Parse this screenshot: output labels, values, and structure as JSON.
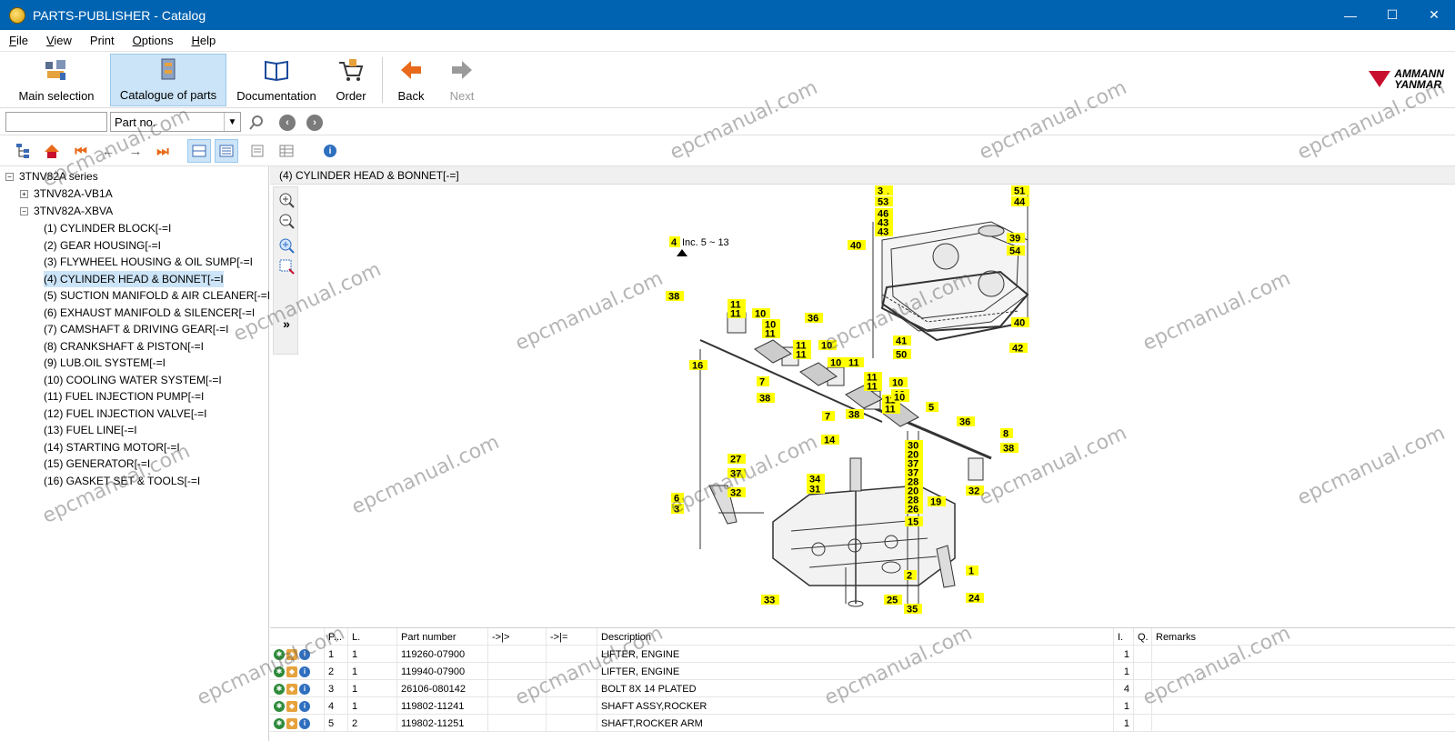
{
  "window": {
    "title": "PARTS-PUBLISHER - Catalog",
    "minimize": "—",
    "maximize": "☐",
    "close": "✕"
  },
  "menu": [
    {
      "u": "F",
      "rest": "ile"
    },
    {
      "u": "V",
      "rest": "iew"
    },
    {
      "u": "",
      "rest": "Print"
    },
    {
      "u": "O",
      "rest": "ptions"
    },
    {
      "u": "H",
      "rest": "elp"
    }
  ],
  "toolbar": {
    "main_selection": "Main selection",
    "catalogue": "Catalogue of parts",
    "documentation": "Documentation",
    "order": "Order",
    "back": "Back",
    "next": "Next"
  },
  "brand": {
    "line1": "AMMANN",
    "line2": "YANMAR",
    "color": "#c8102e"
  },
  "search": {
    "value": "",
    "combo_value": "Part no."
  },
  "tree": {
    "root": "3TNV82A series",
    "node1": "3TNV82A-VB1A",
    "node2": "3TNV82A-XBVA",
    "items": [
      "(1) CYLINDER BLOCK[-=I",
      "(2) GEAR HOUSING[-=I",
      "(3) FLYWHEEL HOUSING & OIL SUMP[-=I",
      "(4) CYLINDER HEAD & BONNET[-=I",
      "(5) SUCTION MANIFOLD & AIR CLEANER[-=I",
      "(6) EXHAUST MANIFOLD & SILENCER[-=I",
      "(7) CAMSHAFT & DRIVING GEAR[-=I",
      "(8) CRANKSHAFT & PISTON[-=I",
      "(9) LUB.OIL SYSTEM[-=I",
      "(10) COOLING WATER SYSTEM[-=I",
      "(11) FUEL INJECTION PUMP[-=I",
      "(12) FUEL INJECTION VALVE[-=I",
      "(13) FUEL LINE[-=I",
      "(14) STARTING MOTOR[-=I",
      "(15) GENERATOR[-=I",
      "(16) GASKET SET & TOOLS[-=I"
    ]
  },
  "drawing": {
    "header": "(4) CYLINDER HEAD & BONNET[-=]",
    "inc_note": "Inc. 5 ~ 13",
    "inc_num": "4",
    "expand": "»"
  },
  "callouts": [
    "51",
    "53",
    "46",
    "43",
    "43",
    "40",
    "51",
    "44",
    "39",
    "54",
    "40",
    "41",
    "50",
    "42",
    "38",
    "11",
    "11",
    "10",
    "10",
    "11",
    "36",
    "11",
    "11",
    "10",
    "10",
    "11",
    "38",
    "11",
    "11",
    "10",
    "16",
    "7",
    "38",
    "7",
    "10",
    "11",
    "11",
    "10",
    "5",
    "36",
    "8",
    "38",
    "14",
    "30",
    "20",
    "37",
    "37",
    "28",
    "20",
    "28",
    "26",
    "19",
    "15",
    "27",
    "37",
    "34",
    "31",
    "32",
    "32",
    "6",
    "3",
    "1",
    "2",
    "33",
    "25",
    "35",
    "24",
    "3"
  ],
  "grid": {
    "columns": [
      "P...",
      "L.",
      "Part number",
      "->|>",
      "->|=",
      "Description",
      "I.",
      "Q.",
      "Remarks"
    ],
    "rows": [
      {
        "p": "1",
        "l": "1",
        "part": "119260-07900",
        "desc": "LIFTER, ENGINE",
        "q": "1"
      },
      {
        "p": "2",
        "l": "1",
        "part": "119940-07900",
        "desc": "LIFTER, ENGINE",
        "q": "1"
      },
      {
        "p": "3",
        "l": "1",
        "part": "26106-080142",
        "desc": "BOLT 8X 14 PLATED",
        "q": "4"
      },
      {
        "p": "4",
        "l": "1",
        "part": "119802-11241",
        "desc": "SHAFT ASSY,ROCKER",
        "q": "1"
      },
      {
        "p": "5",
        "l": "2",
        "part": "119802-11251",
        "desc": "SHAFT,ROCKER ARM",
        "q": "1"
      }
    ]
  },
  "watermark": "epcmanual.com"
}
